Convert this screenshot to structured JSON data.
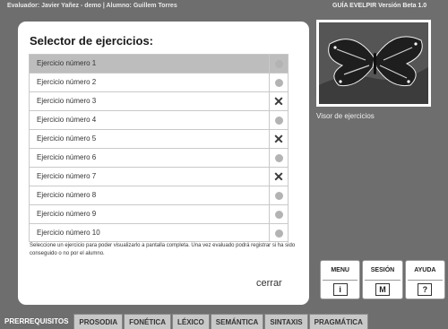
{
  "header": {
    "evaluator": "Evaluador: Javier Yañez - demo | Alumno: Guillem Torres",
    "guide": "GUÍA EVELPIR Versión Beta 1.0"
  },
  "selector": {
    "title": "Selector de ejercicios:",
    "exercises": [
      {
        "label": "Ejercicio número 1",
        "status": "pending"
      },
      {
        "label": "Ejercicio número 2",
        "status": "pending"
      },
      {
        "label": "Ejercicio número 3",
        "status": "failed"
      },
      {
        "label": "Ejercicio número 4",
        "status": "pending"
      },
      {
        "label": "Ejercicio número 5",
        "status": "failed"
      },
      {
        "label": "Ejercicio número 6",
        "status": "pending"
      },
      {
        "label": "Ejercicio número 7",
        "status": "failed"
      },
      {
        "label": "Ejercicio número 8",
        "status": "pending"
      },
      {
        "label": "Ejercicio número 9",
        "status": "pending"
      },
      {
        "label": "Ejercicio número 10",
        "status": "pending"
      }
    ],
    "instructions": "Seleccione un ejercicio para poder visualizarlo a pantalla completa. Una vez evaluado podrá registrar si ha sido conseguido o no por el alumno.",
    "close_label": "cerrar"
  },
  "viewer": {
    "image_icon": "butterfly-image",
    "label": "Visor de ejercicios"
  },
  "buttons": [
    {
      "label": "MENU",
      "icon": "info-icon",
      "glyph": "i"
    },
    {
      "label": "SESIÓN",
      "icon": "session-icon",
      "glyph": "M"
    },
    {
      "label": "AYUDA",
      "icon": "help-icon",
      "glyph": "?"
    }
  ],
  "tabs": [
    "PRERREQUISITOS",
    "PROSODIA",
    "FONÉTICA",
    "LÉXICO",
    "SEMÁNTICA",
    "SINTAXIS",
    "PRAGMÁTICA"
  ],
  "active_tab": 0,
  "colors": {
    "background": "#6e6e6e",
    "panel": "#ffffff",
    "selected_row": "#bdbdbd",
    "tab_inactive": "#c8c8c8"
  }
}
